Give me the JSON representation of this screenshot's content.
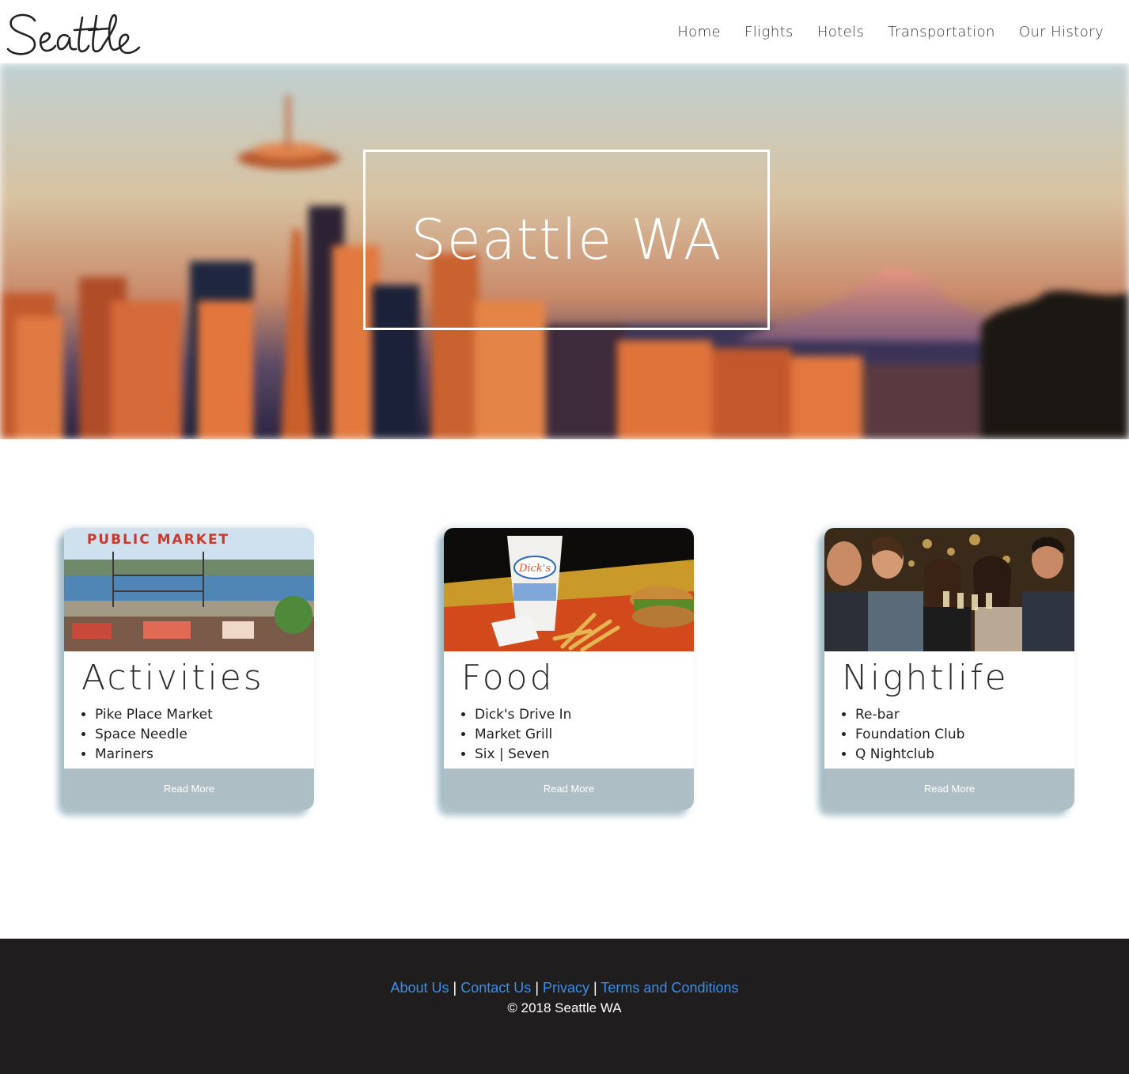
{
  "header": {
    "logo_text": "Seattle",
    "nav": [
      {
        "label": "Home"
      },
      {
        "label": "Flights"
      },
      {
        "label": "Hotels"
      },
      {
        "label": "Transportation"
      },
      {
        "label": "Our History"
      }
    ]
  },
  "hero": {
    "title": "Seattle WA"
  },
  "cards": [
    {
      "title": "Activities",
      "image": "public-market-photo",
      "image_sign_text": "PUBLIC MARKET",
      "items": [
        "Pike Place Market",
        "Space Needle",
        "Mariners"
      ],
      "button_label": "Read More"
    },
    {
      "title": "Food",
      "image": "dicks-drive-in-photo",
      "image_cup_text": "Dick's",
      "items": [
        "Dick's Drive In",
        "Market Grill",
        "Six | Seven"
      ],
      "button_label": "Read More"
    },
    {
      "title": "Nightlife",
      "image": "friends-toasting-photo",
      "items": [
        "Re-bar",
        "Foundation Club",
        "Q Nightclub"
      ],
      "button_label": "Read More"
    }
  ],
  "footer": {
    "links": [
      {
        "label": "About Us"
      },
      {
        "label": "Contact Us"
      },
      {
        "label": "Privacy"
      },
      {
        "label": "Terms and Conditions"
      }
    ],
    "separator": "|",
    "copyright": "© 2018 Seattle WA"
  },
  "colors": {
    "button_bg": "#adbec4",
    "footer_bg": "#1f1d1e",
    "footer_link": "#3d8ee6",
    "card_shadow": "#5f8796"
  }
}
